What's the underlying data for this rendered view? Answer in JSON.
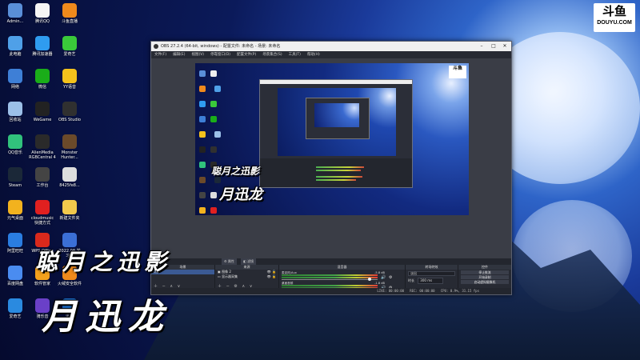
{
  "desktop": {
    "icons": [
      {
        "label": "Admin...",
        "icon": "computer-icon",
        "color": "#5a8fd8"
      },
      {
        "label": "腾讯QQ",
        "icon": "qq-icon",
        "color": "#f5f5f5"
      },
      {
        "label": "斗鱼直播",
        "icon": "douyu-app-icon",
        "color": "#f08a1c"
      },
      {
        "label": "此电脑",
        "icon": "pc-icon",
        "color": "#4fa0e8"
      },
      {
        "label": "腾讯加速器",
        "icon": "accelerator-icon",
        "color": "#2f9cf0"
      },
      {
        "label": "爱奇艺",
        "icon": "iqiyi-icon",
        "color": "#3ac93a"
      },
      {
        "label": "网络",
        "icon": "network-icon",
        "color": "#3e7fd6"
      },
      {
        "label": "微信",
        "icon": "wechat-icon",
        "color": "#1aad19"
      },
      {
        "label": "YY语音",
        "icon": "yy-icon",
        "color": "#f4c21c"
      },
      {
        "label": "回收站",
        "icon": "recycle-bin-icon",
        "color": "#9cc0e8"
      },
      {
        "label": "WeGame",
        "icon": "wegame-icon",
        "color": "#222"
      },
      {
        "label": "OBS Studio",
        "icon": "obs-icon",
        "color": "#303030"
      },
      {
        "label": "QQ音乐",
        "icon": "qqmusic-icon",
        "color": "#31c27c"
      },
      {
        "label": "AlienMedia RGBCentral 4",
        "icon": "alienware-icon",
        "color": "#2a2a2a"
      },
      {
        "label": "Monster Hunter...",
        "icon": "monster-hunter-icon",
        "color": "#6b4a2a"
      },
      {
        "label": "Steam",
        "icon": "steam-icon",
        "color": "#1b2838"
      },
      {
        "label": "工作台",
        "icon": "desktop-app-icon",
        "color": "#444"
      },
      {
        "label": "8425fe8...",
        "icon": "file-icon",
        "color": "#ddd"
      },
      {
        "label": "元气桌面",
        "icon": "yuanqi-icon",
        "color": "#f2b21e"
      },
      {
        "label": "cloudmusic 快捷方式",
        "icon": "netease-music-icon",
        "color": "#e02020"
      },
      {
        "label": "新建文件夹",
        "icon": "folder-icon",
        "color": "#f2c94c"
      },
      {
        "label": "阿里旺旺",
        "icon": "wangwang-icon",
        "color": "#2a7de1"
      },
      {
        "label": "WPS Office",
        "icon": "wps-icon",
        "color": "#d9291c"
      },
      {
        "label": "2022.08 学习...",
        "icon": "doc-icon",
        "color": "#3b6fd6"
      },
      {
        "label": "百度网盘",
        "icon": "baidu-netdisk-icon",
        "color": "#4a8cf0"
      },
      {
        "label": "软件管家",
        "icon": "software-manager-icon",
        "color": "#f3a11c"
      },
      {
        "label": "火绒安全软件",
        "icon": "huorong-icon",
        "color": "#f08a1c"
      },
      {
        "label": "爱奇艺",
        "icon": "app-icon",
        "color": "#2a8ae0"
      },
      {
        "label": "骑乐音",
        "icon": "music-app-icon",
        "color": "#6a40c8"
      },
      {
        "label": "迅雷",
        "icon": "xunlei-icon",
        "color": "#1f7ae0"
      }
    ]
  },
  "douyu_logo": {
    "line1": "斗鱼",
    "line2": "DOUYU.COM"
  },
  "overlay": {
    "line1": "聪月之迅影",
    "line2": "月迅龙"
  },
  "obs": {
    "title": "OBS 27.2.4 (64-bit, windows) - 配置文件: 未命名 - 场景: 未命名",
    "menu": [
      "文件(F)",
      "编辑(E)",
      "视图(V)",
      "停靠窗口(D)",
      "配置文件(P)",
      "场景集合(S)",
      "工具(T)",
      "帮助(H)"
    ],
    "no_source": "未选择源",
    "props_button": "属性",
    "filters_button": "滤镜",
    "scenes": {
      "header": "场景",
      "items": [
        "场景"
      ]
    },
    "sources": {
      "header": "来源",
      "items": [
        "图像 2",
        "显示器采集"
      ]
    },
    "mixer": {
      "header": "混音器",
      "channels": [
        {
          "name": "麦克风/Aux",
          "db": "-5.8 dB"
        },
        {
          "name": "桌面音频",
          "db": "-1.8 dB"
        }
      ]
    },
    "transitions": {
      "header": "转场特效",
      "type": "淡出",
      "duration_label": "时长",
      "duration": "300 ms"
    },
    "controls": {
      "header": "控件",
      "buttons": [
        "停止推流",
        "开始录制",
        "启动虚拟摄像机",
        "工作室模式",
        "设置",
        "退出"
      ]
    },
    "status": {
      "live": "LIVE: 00:00:00",
      "rec": "REC: 00:00:00",
      "cpu": "CPU: 0.9%, 31.15 fps"
    }
  }
}
